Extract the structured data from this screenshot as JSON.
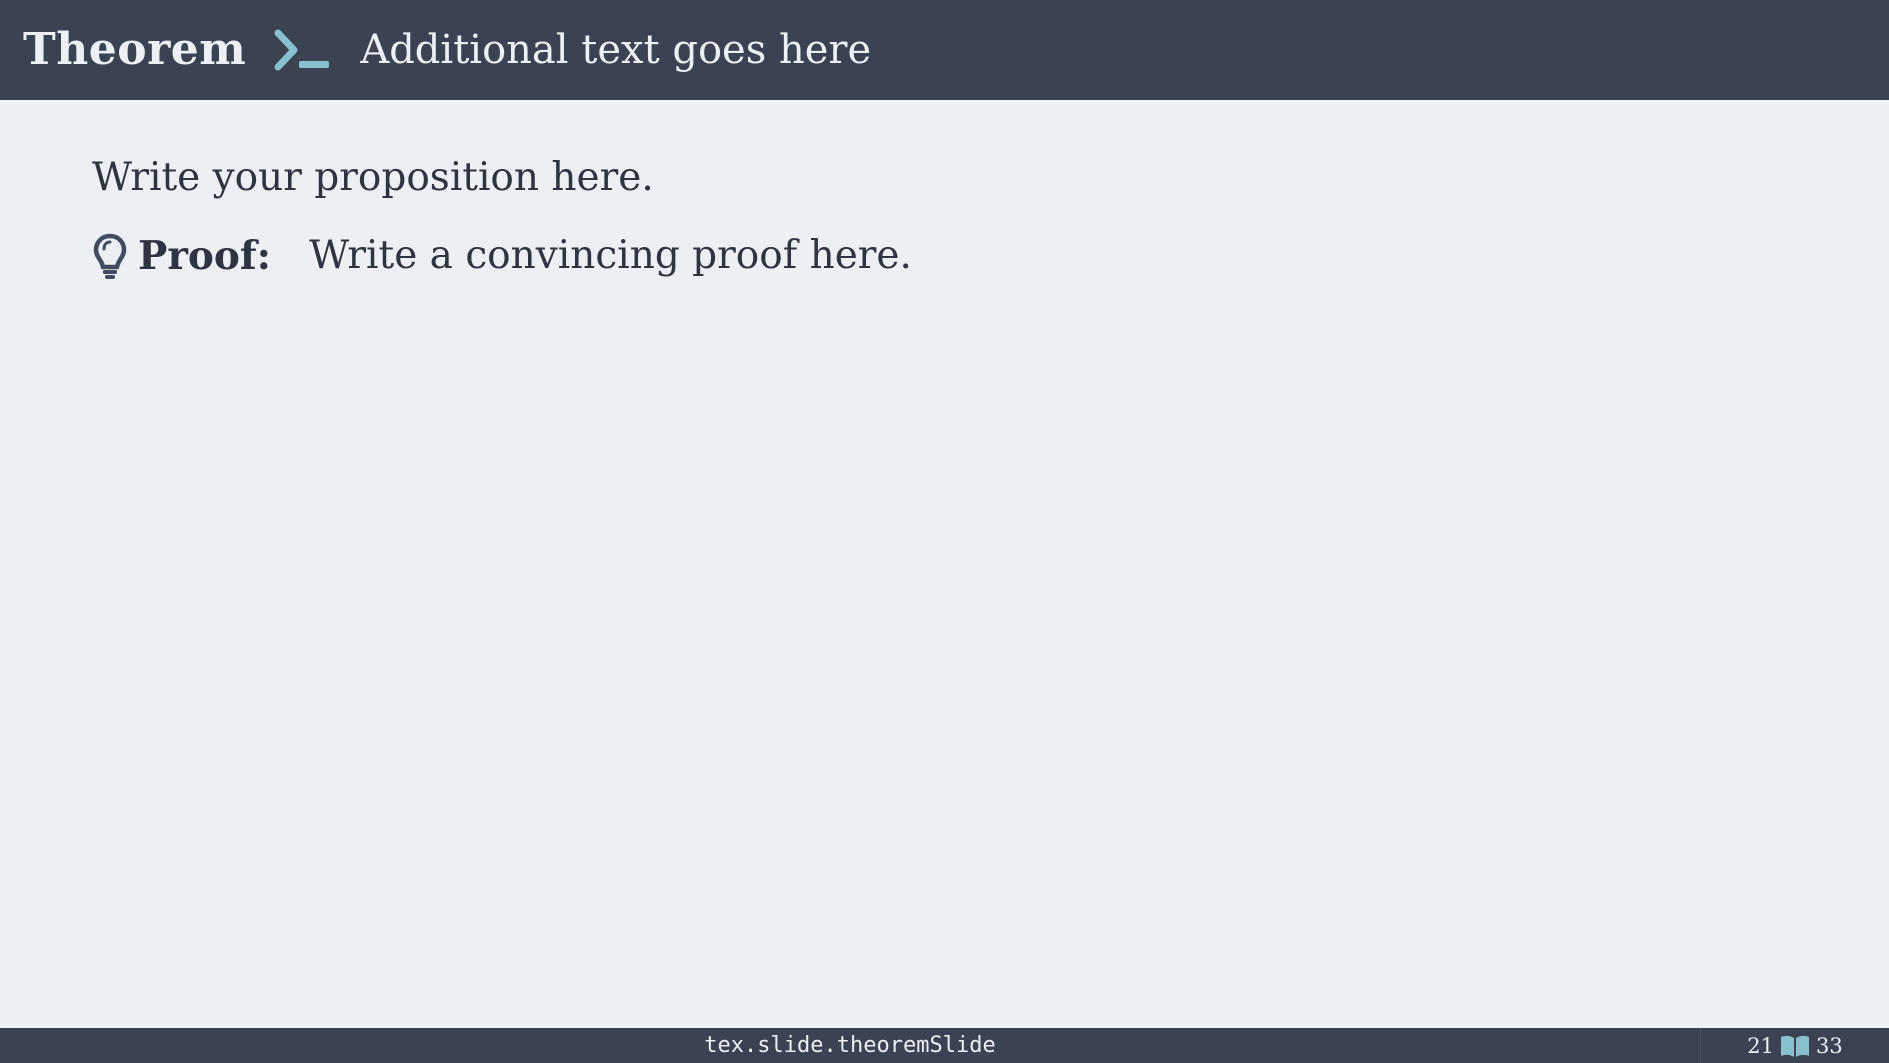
{
  "colors": {
    "bar_bg": "#3b4252",
    "slide_bg": "#eceff4",
    "bar_text": "#eceff4",
    "body_text": "#2e3440",
    "accent": "#88c0d0",
    "icon_dark": "#434c5e"
  },
  "header": {
    "title": "Theorem",
    "icon": "terminal-prompt-icon",
    "subtitle": "Additional text goes here"
  },
  "body": {
    "proposition": "Write your proposition here.",
    "proof": {
      "icon": "lightbulb-icon",
      "label": "Proof:",
      "text": "Write a convincing proof here."
    }
  },
  "footer": {
    "label": "tex.slide.theoremSlide",
    "current_page": "21",
    "icon": "book-icon",
    "total_pages": "33"
  }
}
